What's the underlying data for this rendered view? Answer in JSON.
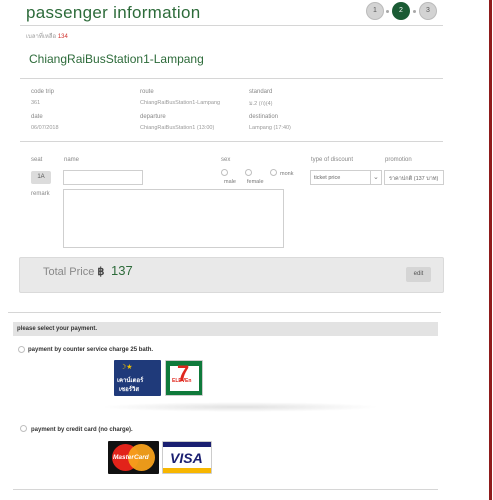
{
  "header": {
    "title": "passenger information",
    "remaining_label": "เบลาที่เหลือ",
    "remaining_value": "134",
    "steps": [
      "1",
      "2",
      "3"
    ],
    "active_step": 2
  },
  "trip": {
    "route_title": "ChiangRaiBusStation1-Lampang",
    "code_trip_label": "code trip",
    "code_trip_value": "361",
    "route_label": "route",
    "route_value": "ChiangRaiBusStation1-Lampang",
    "standard_label": "standard",
    "standard_value": "ม.2 (ก)(4)",
    "date_label": "date",
    "date_value": "06/07/2018",
    "departure_label": "departure",
    "departure_value": "ChiangRaiBusStation1 (13:00)",
    "destination_label": "destination",
    "destination_value": "Lampang (17:40)"
  },
  "passenger": {
    "seat_label": "seat",
    "seat_value": "1A",
    "name_label": "name",
    "name_value": "",
    "sex_label": "sex",
    "sex_options": [
      "male",
      "female",
      "monk"
    ],
    "discount_label": "type of discount",
    "discount_value": "ticket price",
    "promotion_label": "promotion",
    "promotion_value": "ราคาปกติ (137 บาท)",
    "remark_label": "remark",
    "remark_value": ""
  },
  "total": {
    "label": "Total Price",
    "currency": "฿",
    "amount": "137",
    "edit_label": "edit"
  },
  "payment": {
    "header": "please select your payment.",
    "option_counter": "payment by counter service charge 25 bath.",
    "option_credit": "payment by credit card (no charge).",
    "counter_logo_text": [
      "เคาน์เตอร์",
      "เซอร์วิส"
    ],
    "seven_logo_text": [
      "7",
      "ELEVEn"
    ],
    "mastercard_text": "MasterCard",
    "visa_text": "VISA"
  },
  "colors": {
    "brand_green": "#2d6b3a",
    "active_step": "#1a5b34",
    "accent_red": "#d0312d",
    "side_bar": "#8e1b1b"
  }
}
